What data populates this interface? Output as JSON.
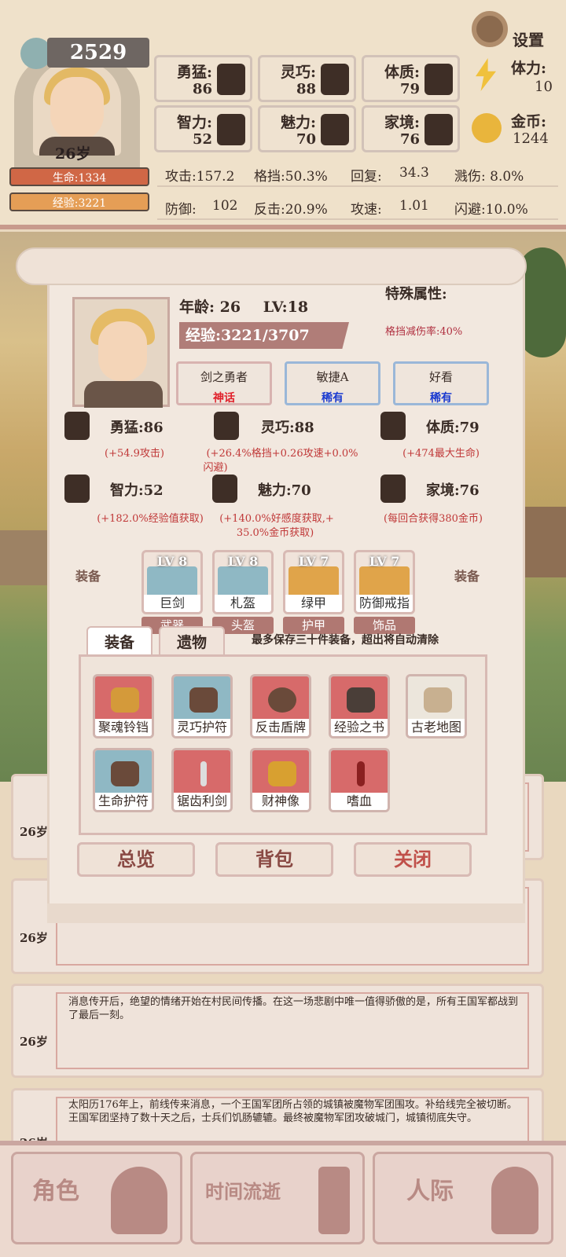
{
  "header": {
    "score": "2529",
    "age": "26岁",
    "hp_label": "生命:1334",
    "xp_label": "经验:3221",
    "settings_label": "设置",
    "stats": [
      {
        "label": "勇猛:",
        "value": "86"
      },
      {
        "label": "灵巧:",
        "value": "88"
      },
      {
        "label": "体质:",
        "value": "79"
      },
      {
        "label": "智力:",
        "value": "52"
      },
      {
        "label": "魅力:",
        "value": "70"
      },
      {
        "label": "家境:",
        "value": "76"
      }
    ],
    "stamina_label": "体力:",
    "stamina_value": "10",
    "gold_label": "金币:",
    "gold_value": "1244",
    "combat": {
      "attack": "攻击:157.2",
      "block": "格挡:50.3%",
      "regen_label": "回复:",
      "regen_value": "34.3",
      "splash": "溅伤: 8.0%",
      "defense_label": "防御:",
      "defense_value": "102",
      "counter": "反击:20.9%",
      "speed_label": "攻速:",
      "speed_value": "1.01",
      "dodge": "闪避:10.0%"
    }
  },
  "panel": {
    "age_label": "年龄:",
    "age_value": "26",
    "level": "LV:18",
    "exp": "经验:3221/3707",
    "special_title": "特殊属性:",
    "special_value": "格挡减伤率:40%",
    "traits": [
      {
        "name": "剑之勇者",
        "rarity": "神话",
        "color": "#e0202a"
      },
      {
        "name": "敏捷A",
        "rarity": "稀有",
        "color": "#1a3ad0"
      },
      {
        "name": "好看",
        "rarity": "稀有",
        "color": "#1a3ad0"
      }
    ],
    "attributes": [
      {
        "name": "勇猛:86",
        "effect": "(+54.9攻击)"
      },
      {
        "name": "灵巧:88",
        "effect": "(+26.4%格挡+0.26攻速+0.0%",
        "effect2": "闪避)"
      },
      {
        "name": "体质:79",
        "effect": "(+474最大生命)"
      },
      {
        "name": "智力:52",
        "effect": "(+182.0%经验值获取)"
      },
      {
        "name": "魅力:70",
        "effect": "(+140.0%好感度获取,+",
        "effect2": "35.0%金币获取)"
      },
      {
        "name": "家境:76",
        "effect": "(每回合获得380金币)"
      }
    ],
    "equip_label": "装备",
    "equipment": [
      {
        "lv": "LV 8",
        "name": "巨剑",
        "type": "武器",
        "bg": "#8fb8c4"
      },
      {
        "lv": "LV 8",
        "name": "札盔",
        "type": "头盔",
        "bg": "#8fb8c4"
      },
      {
        "lv": "LV 7",
        "name": "绿甲",
        "type": "护甲",
        "bg": "#e0a44a"
      },
      {
        "lv": "LV 7",
        "name": "防御戒指",
        "type": "饰品",
        "bg": "#e0a44a"
      }
    ],
    "tabs": [
      "装备",
      "遗物"
    ],
    "tab_note": "最多保存三十件装备，超出将自动清除",
    "inventory": [
      {
        "name": "聚魂铃铛",
        "bg": "#d76a6a"
      },
      {
        "name": "灵巧护符",
        "bg": "#8fb8c4"
      },
      {
        "name": "反击盾牌",
        "bg": "#d76a6a"
      },
      {
        "name": "经验之书",
        "bg": "#d76a6a"
      },
      {
        "name": "古老地图",
        "bg": "#ece6dc"
      },
      {
        "name": "生命护符",
        "bg": "#8fb8c4"
      },
      {
        "name": "锯齿利剑",
        "bg": "#d76a6a"
      },
      {
        "name": "财神像",
        "bg": "#d76a6a"
      },
      {
        "name": "嗜血",
        "bg": "#d76a6a"
      }
    ],
    "buttons": {
      "overview": "总览",
      "bag": "背包",
      "close": "关闭"
    }
  },
  "log": [
    {
      "age": "26岁",
      "text": ""
    },
    {
      "age": "26岁",
      "text": ""
    },
    {
      "age": "26岁",
      "text": "消息传开后，绝望的情绪开始在村民间传播。在这一场悲剧中唯一值得骄傲的是，所有王国军都战到了最后一刻。"
    },
    {
      "age": "26岁",
      "text": "太阳历176年上，前线传来消息，一个王国军团所占领的城镇被魔物军团围攻。补给线完全被切断。王国军团坚持了数十天之后，士兵们饥肠辘辘。最终被魔物军团攻破城门，城镇彻底失守。"
    }
  ],
  "nav": {
    "character": "角色",
    "time": "时间流逝",
    "social": "人际"
  }
}
